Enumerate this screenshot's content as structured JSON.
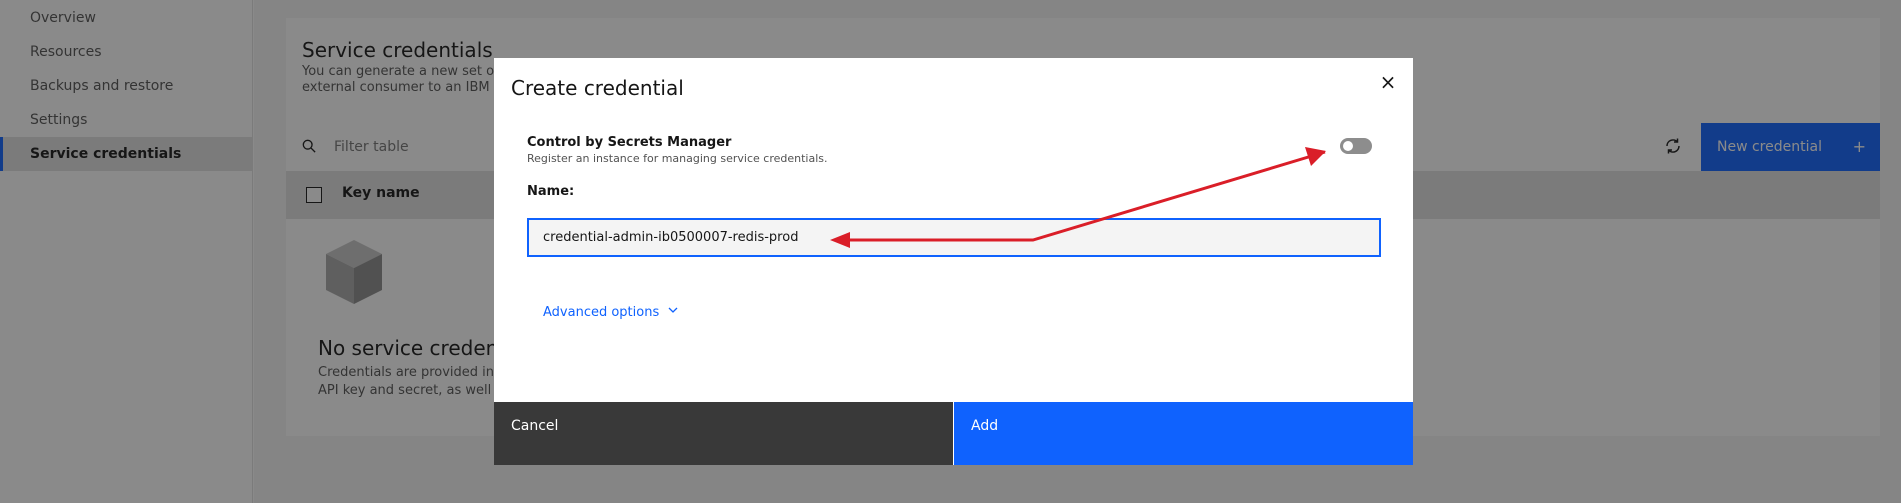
{
  "sidebar": {
    "items": [
      {
        "label": "Overview"
      },
      {
        "label": "Resources"
      },
      {
        "label": "Backups and restore"
      },
      {
        "label": "Settings"
      },
      {
        "label": "Service credentials",
        "active": true
      }
    ]
  },
  "page": {
    "title": "Service credentials",
    "description_line1": "You can generate a new set of",
    "description_line2": "external consumer to an IBM C",
    "filter_placeholder": "Filter table",
    "new_credential_label": "New credential",
    "new_credential_icon": "plus-icon",
    "table": {
      "columns": [
        "Key name"
      ]
    },
    "empty": {
      "title": "No service credentia",
      "desc_line1": "Credentials are provided in",
      "desc_line2": "API key and secret, as well"
    }
  },
  "modal": {
    "title": "Create credential",
    "close_icon": "close-icon",
    "toggle": {
      "label": "Control by Secrets Manager",
      "helper": "Register an instance for managing service credentials.",
      "on": false
    },
    "name_label": "Name:",
    "name_value": "credential-admin-ib0500007-redis-prod",
    "advanced_label": "Advanced options",
    "cancel_label": "Cancel",
    "add_label": "Add"
  },
  "colors": {
    "primary": "#0f62fe",
    "secondary_button": "#393939",
    "annotation_arrow": "#da1e28"
  }
}
